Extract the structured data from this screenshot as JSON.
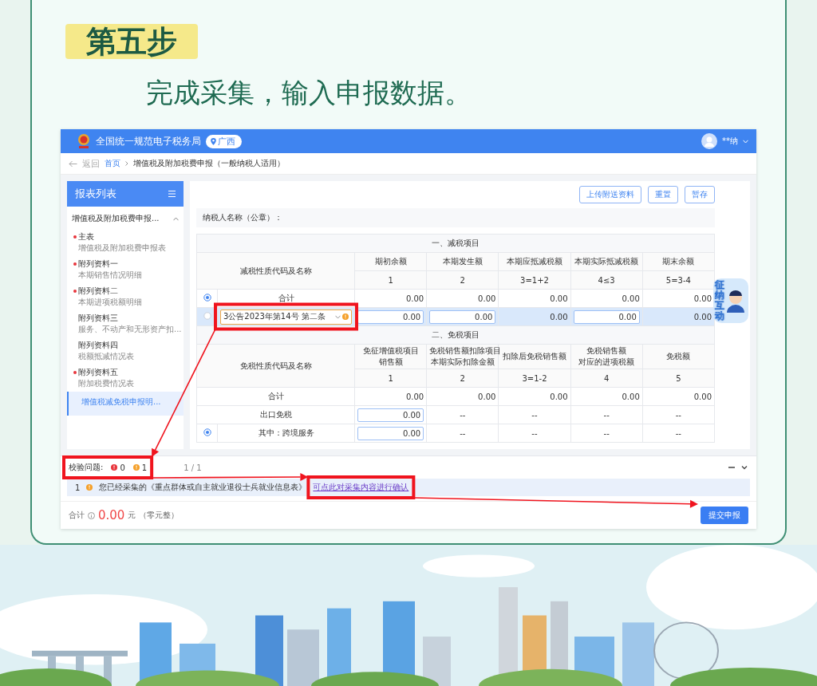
{
  "step": {
    "label": "第五步",
    "subtitle": "完成采集，输入申报数据。"
  },
  "app": {
    "header": {
      "title": "全国统一规范电子税务局",
      "region": "广西",
      "user": "**纳"
    },
    "breadcrumb": {
      "back": "返回",
      "items": [
        {
          "label": "首页",
          "link": true
        },
        {
          "label": "增值税及附加税费申报（一般纳税人适用）",
          "link": false
        }
      ]
    },
    "sidebar": {
      "title": "报表列表",
      "group": {
        "label": "增值税及附加税费申报...",
        "expanded": true
      },
      "items": [
        {
          "title": "主表",
          "subtitle": "增值税及附加税费申报表",
          "required": true,
          "selected": false
        },
        {
          "title": "附列资料一",
          "subtitle": "本期销售情况明细",
          "required": true,
          "selected": false
        },
        {
          "title": "附列资料二",
          "subtitle": "本期进项税额明细",
          "required": true,
          "selected": false
        },
        {
          "title": "附列资料三",
          "subtitle": "服务、不动产和无形资产扣...",
          "required": false,
          "selected": false
        },
        {
          "title": "附列资料四",
          "subtitle": "税额抵减情况表",
          "required": false,
          "selected": false
        },
        {
          "title": "附列资料五",
          "subtitle": "附加税费情况表",
          "required": true,
          "selected": false
        },
        {
          "title": "增值税减免税申报明...",
          "required": false,
          "selected": true
        }
      ]
    },
    "toolbar": [
      "上传附送资料",
      "重置",
      "暂存"
    ],
    "taxpayer_label": "纳税人名称（公章）：",
    "sections": [
      {
        "title": "一、减税项目",
        "name_header": "减税性质代码及名称",
        "columns": [
          {
            "lines": [
              "期初余额"
            ],
            "index": "1"
          },
          {
            "lines": [
              "本期发生额"
            ],
            "index": "2"
          },
          {
            "lines": [
              "本期应抵减税额"
            ],
            "index": "3=1+2"
          },
          {
            "lines": [
              "本期实际抵减税额"
            ],
            "index": "4≤3"
          },
          {
            "lines": [
              "期末余额"
            ],
            "index": "5=3-4"
          }
        ],
        "rows": [
          {
            "kind": "radio",
            "radio_checked": true,
            "label": "合计",
            "selected": false,
            "cells": [
              {
                "kind": "text",
                "value": "0.00"
              },
              {
                "kind": "text",
                "value": "0.00"
              },
              {
                "kind": "text",
                "value": "0.00"
              },
              {
                "kind": "text",
                "value": "0.00"
              },
              {
                "kind": "text",
                "value": "0.00"
              }
            ]
          },
          {
            "kind": "select",
            "radio_checked": false,
            "label": "3公告2023年第14号 第二条",
            "warning": true,
            "annotated": true,
            "selected": true,
            "cells": [
              {
                "kind": "input",
                "value": "0.00"
              },
              {
                "kind": "input",
                "value": "0.00"
              },
              {
                "kind": "text",
                "value": "0.00"
              },
              {
                "kind": "input",
                "value": "0.00"
              },
              {
                "kind": "text",
                "value": "0.00"
              }
            ]
          }
        ]
      },
      {
        "title": "二、免税项目",
        "name_header": "免税性质代码及名称",
        "columns": [
          {
            "lines": [
              "免征增值税项目",
              "销售额"
            ],
            "index": "1"
          },
          {
            "lines": [
              "免税销售额扣除项目",
              "本期实际扣除金额"
            ],
            "index": "2"
          },
          {
            "lines": [
              "扣除后免税销售额"
            ],
            "index": "3=1-2"
          },
          {
            "lines": [
              "免税销售额",
              "对应的进项税额"
            ],
            "index": "4"
          },
          {
            "lines": [
              "免税额"
            ],
            "index": "5"
          }
        ],
        "rows": [
          {
            "kind": "plain",
            "label": "合计",
            "selected": false,
            "cells": [
              {
                "kind": "text",
                "value": "0.00"
              },
              {
                "kind": "text",
                "value": "0.00"
              },
              {
                "kind": "text",
                "value": "0.00"
              },
              {
                "kind": "text",
                "value": "0.00"
              },
              {
                "kind": "text",
                "value": "0.00"
              }
            ]
          },
          {
            "kind": "plain",
            "label": "出口免税",
            "selected": false,
            "cells": [
              {
                "kind": "input",
                "value": "0.00"
              },
              {
                "kind": "text",
                "value": "--"
              },
              {
                "kind": "text",
                "value": "--"
              },
              {
                "kind": "text",
                "value": "--"
              },
              {
                "kind": "text",
                "value": "--"
              }
            ]
          },
          {
            "kind": "radio",
            "radio_checked": true,
            "label": "其中：跨境服务",
            "selected": false,
            "cells": [
              {
                "kind": "input",
                "value": "0.00"
              },
              {
                "kind": "text",
                "value": "--"
              },
              {
                "kind": "text",
                "value": "--"
              },
              {
                "kind": "text",
                "value": "--"
              },
              {
                "kind": "text",
                "value": "--"
              }
            ]
          }
        ]
      }
    ],
    "assistant": {
      "label": "征纳互动"
    },
    "validation": {
      "label": "校验问题:",
      "errors": "0",
      "warnings": "1",
      "annotated": true,
      "page": "1 / 1",
      "messages": [
        {
          "index": "1",
          "text": "您已经采集的《重点群体或自主就业退役士兵就业信息表》",
          "link": "可点此对采集内容进行确认",
          "link_annotated": true
        }
      ]
    },
    "footer": {
      "label": "合计",
      "amount": "0.00",
      "unit": "元",
      "amount_words": "（零元整）",
      "submit": "提交申报"
    }
  }
}
